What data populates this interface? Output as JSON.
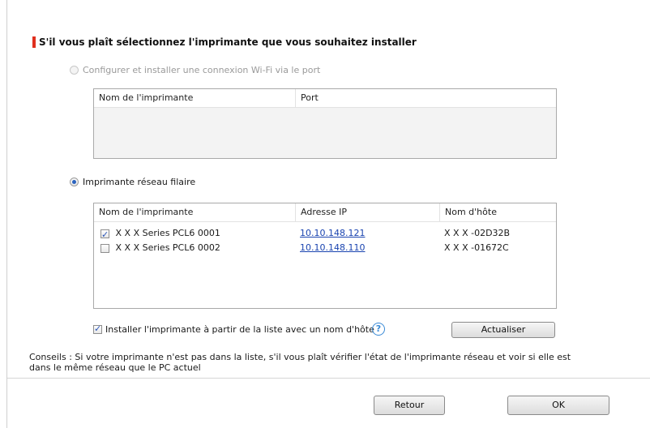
{
  "header": {
    "title": "S'il vous plaît sélectionnez l'imprimante que vous souhaitez installer"
  },
  "wifi_option": {
    "label": "Configurer et installer une connexion Wi-Fi via le port",
    "list": {
      "col_printer": "Nom de l'imprimante",
      "col_port": "Port"
    }
  },
  "wired_option": {
    "label": "Imprimante réseau filaire",
    "list": {
      "col_printer": "Nom de l'imprimante",
      "col_ip": "Adresse IP",
      "col_host": "Nom d'hôte",
      "rows": [
        {
          "checked": true,
          "name": "X X X  Series PCL6 0001",
          "ip": "10.10.148.121",
          "host": "X X X -02D32B"
        },
        {
          "checked": false,
          "name": "X X X  Series PCL6 0002",
          "ip": "10.10.148.110",
          "host": "X X X -01672C"
        }
      ]
    }
  },
  "install_by_hostname": {
    "label": "Installer l'imprimante à partir de la liste avec un nom d'hôte",
    "checked": true,
    "help_glyph": "?"
  },
  "buttons": {
    "refresh": "Actualiser",
    "back": "Retour",
    "ok": "OK"
  },
  "tips": "Conseils : Si votre imprimante n'est pas dans la liste, s'il vous plaît vérifier l'état de l'imprimante réseau et voir si elle est dans le même réseau que le PC actuel",
  "colors": {
    "accent": "#e0301e",
    "link": "#1a44b0",
    "help": "#3a8ad6"
  }
}
